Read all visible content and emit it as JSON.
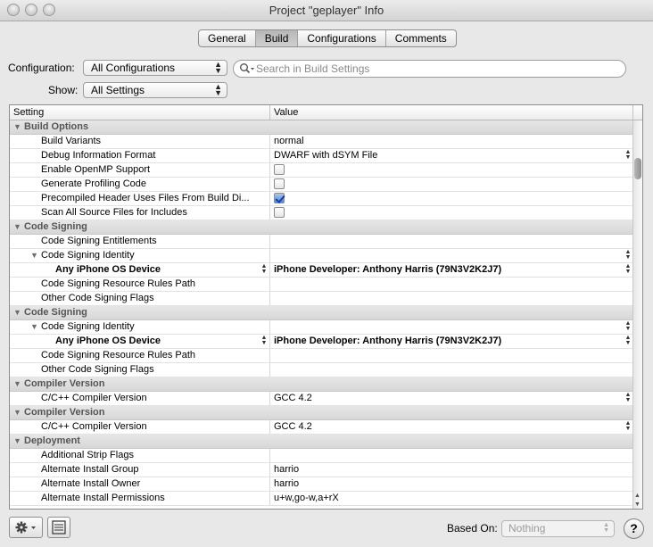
{
  "window": {
    "title": "Project \"geplayer\" Info"
  },
  "tabs": [
    {
      "label": "General",
      "active": false
    },
    {
      "label": "Build",
      "active": true
    },
    {
      "label": "Configurations",
      "active": false
    },
    {
      "label": "Comments",
      "active": false
    }
  ],
  "toolbar": {
    "configuration_label": "Configuration:",
    "configuration_value": "All Configurations",
    "show_label": "Show:",
    "show_value": "All Settings",
    "search_placeholder": "Search in Build Settings"
  },
  "table": {
    "columns": [
      "Setting",
      "Value"
    ],
    "rows": [
      {
        "type": "group",
        "label": "Build Options"
      },
      {
        "type": "item",
        "level": 1,
        "label": "Build Variants",
        "value": "normal"
      },
      {
        "type": "item",
        "level": 1,
        "label": "Debug Information Format",
        "value": "DWARF with dSYM File",
        "popup": true
      },
      {
        "type": "item",
        "level": 1,
        "label": "Enable OpenMP Support",
        "checkbox": false
      },
      {
        "type": "item",
        "level": 1,
        "label": "Generate Profiling Code",
        "checkbox": false
      },
      {
        "type": "item",
        "level": 1,
        "label": "Precompiled Header Uses Files From Build Di...",
        "checkbox": true
      },
      {
        "type": "item",
        "level": 1,
        "label": "Scan All Source Files for Includes",
        "checkbox": false
      },
      {
        "type": "group",
        "label": "Code Signing"
      },
      {
        "type": "item",
        "level": 1,
        "label": "Code Signing Entitlements",
        "value": ""
      },
      {
        "type": "item",
        "level": 1,
        "label": "Code Signing Identity",
        "value": "",
        "expanded": true,
        "popup": true
      },
      {
        "type": "item",
        "level": 2,
        "label": "Any iPhone OS Device",
        "value": "iPhone Developer: Anthony Harris (79N3V2K2J7)",
        "popup": true,
        "keypopup": true
      },
      {
        "type": "item",
        "level": 1,
        "label": "Code Signing Resource Rules Path",
        "value": ""
      },
      {
        "type": "item",
        "level": 1,
        "label": "Other Code Signing Flags",
        "value": ""
      },
      {
        "type": "group",
        "label": "Code Signing"
      },
      {
        "type": "item",
        "level": 1,
        "label": "Code Signing Identity",
        "value": "",
        "expanded": true,
        "popup": true
      },
      {
        "type": "item",
        "level": 2,
        "label": "Any iPhone OS Device",
        "value": "iPhone Developer: Anthony Harris (79N3V2K2J7)",
        "popup": true,
        "keypopup": true
      },
      {
        "type": "item",
        "level": 1,
        "label": "Code Signing Resource Rules Path",
        "value": ""
      },
      {
        "type": "item",
        "level": 1,
        "label": "Other Code Signing Flags",
        "value": ""
      },
      {
        "type": "group",
        "label": "Compiler Version"
      },
      {
        "type": "item",
        "level": 1,
        "label": "C/C++ Compiler Version",
        "value": "GCC 4.2",
        "popup": true
      },
      {
        "type": "group",
        "label": "Compiler Version"
      },
      {
        "type": "item",
        "level": 1,
        "label": "C/C++ Compiler Version",
        "value": "GCC 4.2",
        "popup": true
      },
      {
        "type": "group",
        "label": "Deployment"
      },
      {
        "type": "item",
        "level": 1,
        "label": "Additional Strip Flags",
        "value": ""
      },
      {
        "type": "item",
        "level": 1,
        "label": "Alternate Install Group",
        "value": "harrio"
      },
      {
        "type": "item",
        "level": 1,
        "label": "Alternate Install Owner",
        "value": "harrio"
      },
      {
        "type": "item",
        "level": 1,
        "label": "Alternate Install Permissions",
        "value": "u+w,go-w,a+rX"
      }
    ]
  },
  "footer": {
    "based_on_label": "Based On:",
    "based_on_value": "Nothing",
    "help_label": "?"
  },
  "icons": {
    "action": "gear-icon",
    "layers": "list-icon",
    "search": "magnifier-icon"
  }
}
